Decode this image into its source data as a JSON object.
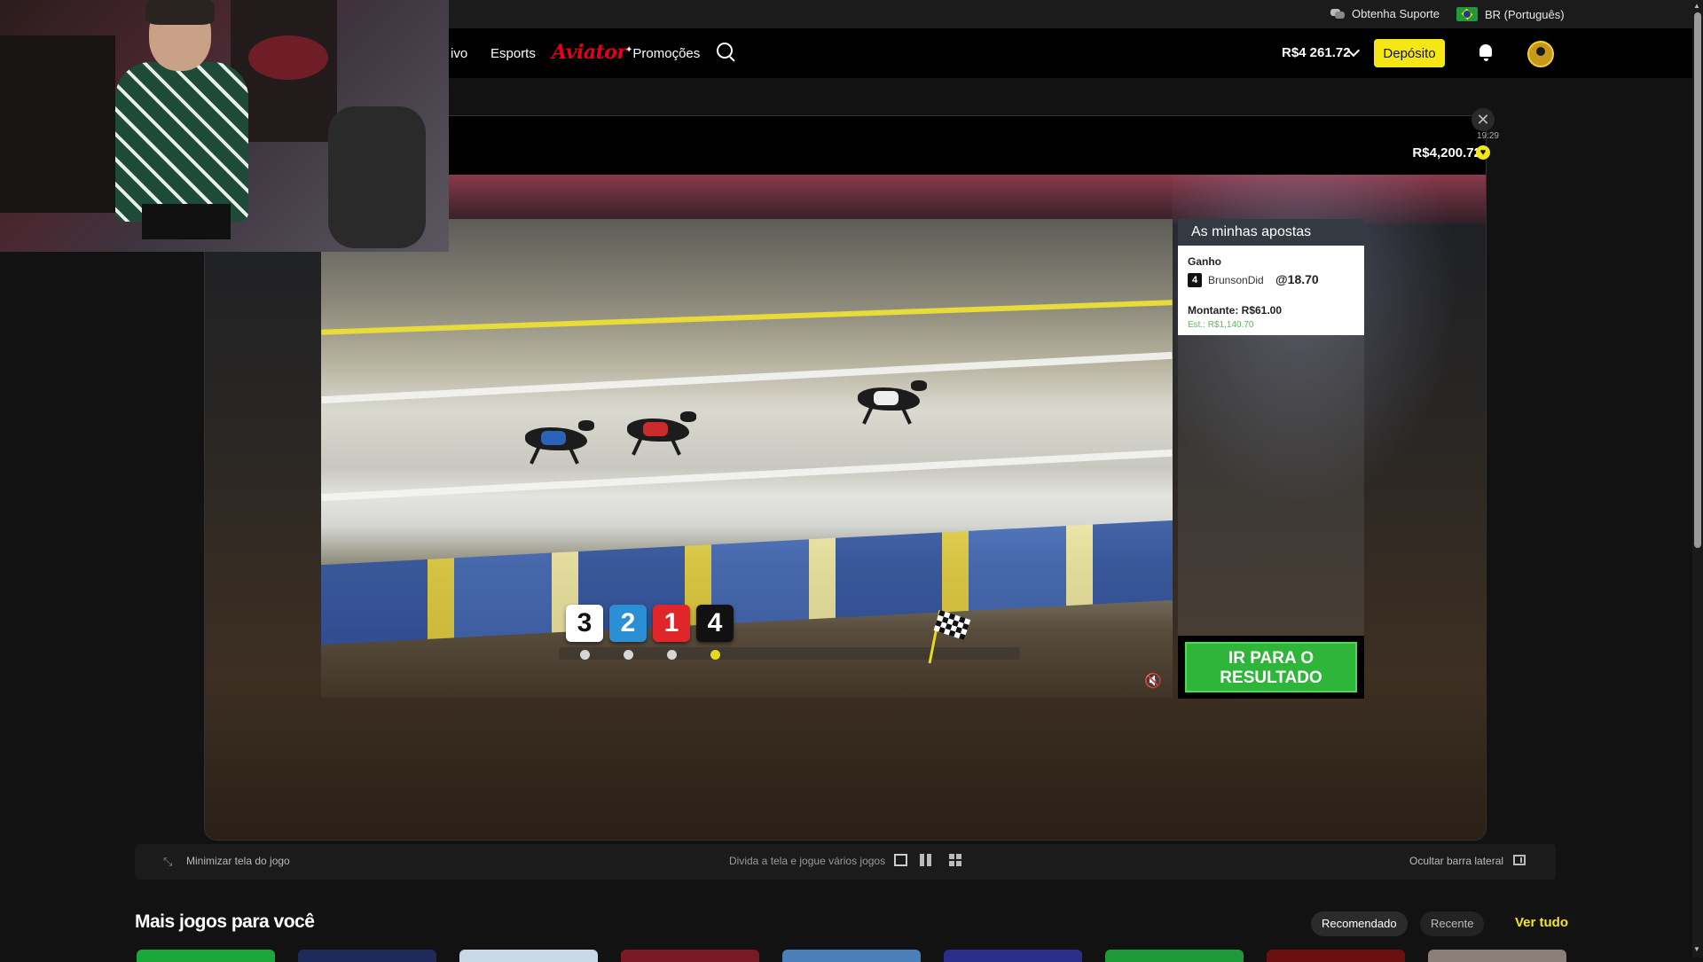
{
  "topbar": {
    "support_label": "Obtenha Suporte",
    "language_label": "BR (Português)"
  },
  "nav": {
    "live_partial": "ivo",
    "esports": "Esports",
    "aviator": "Aviator",
    "promotions": "Promoções",
    "balance": "R$4 261.72",
    "deposit": "Depósito"
  },
  "game": {
    "clock": "19:29",
    "balance": "R$4,200.72",
    "close": "✕",
    "trap_order": [
      "3",
      "2",
      "1",
      "4"
    ],
    "trap_colors": {
      "3": {
        "bg": "#ffffff",
        "fg": "#111111"
      },
      "2": {
        "bg": "#2b8fd6",
        "fg": "#ffffff"
      },
      "1": {
        "bg": "#e0262b",
        "fg": "#ffffff"
      },
      "4": {
        "bg": "#111111",
        "fg": "#ffffff"
      }
    },
    "progress_dots": [
      "#d6d6d6",
      "#d6d6d6",
      "#d6d6d6",
      "#e8d81e"
    ]
  },
  "bets": {
    "title": "As minhas apostas",
    "bet_type": "Ganho",
    "trap_number": "4",
    "runner": "BrunsonDid",
    "odds": "@18.70",
    "amount": "Montante: R$61.00",
    "estimate": "Est.: R$1,140.70",
    "result_button": "IR PARA O RESULTADO"
  },
  "controls": {
    "minimize": "Minimizar tela do jogo",
    "split": "Divida a tela e jogue vários jogos",
    "hide_sidebar": "Ocultar barra lateral"
  },
  "more_games": {
    "title": "Mais jogos para você",
    "tab_recommended": "Recomendado",
    "tab_recent": "Recente",
    "see_all": "Ver tudo",
    "thumb_colors": [
      "#1aa83a",
      "#1d2a5a",
      "#c9d8e6",
      "#7a1a22",
      "#4a7fb8",
      "#2b2f8a",
      "#1f9a3a",
      "#6a1010",
      "#8b7f7a"
    ]
  },
  "colors": {
    "accent_yellow": "#f5e716",
    "result_green": "#2fb53a",
    "aviator_red": "#e2001a"
  }
}
